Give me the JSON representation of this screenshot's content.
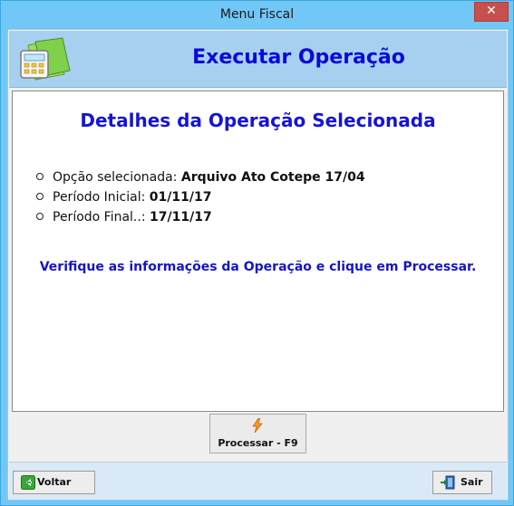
{
  "window": {
    "title": "Menu Fiscal",
    "close_label": "✕"
  },
  "header": {
    "title": "Executar Operação",
    "icon": "calculator-folder-icon"
  },
  "panel": {
    "title": "Detalhes da Operação Selecionada",
    "details": [
      {
        "label": "Opção selecionada: ",
        "value": "Arquivo Ato Cotepe 17/04"
      },
      {
        "label": "Período Inicial: ",
        "value": "01/11/17"
      },
      {
        "label": "Período Final..: ",
        "value": "17/11/17"
      }
    ],
    "notice": "Verifique as informações da Operação e clique em Processar."
  },
  "actions": {
    "process_label": "Processar - F9",
    "process_icon": "lightning-icon"
  },
  "footer": {
    "back_label": "Voltar",
    "back_icon": "back-arrow-icon",
    "exit_label": "Sair",
    "exit_icon": "exit-door-icon"
  },
  "colors": {
    "title_bar": "#71c8f6",
    "header_band": "#a7d0f0",
    "heading_text": "#1515d6",
    "close_button": "#c7504f"
  }
}
